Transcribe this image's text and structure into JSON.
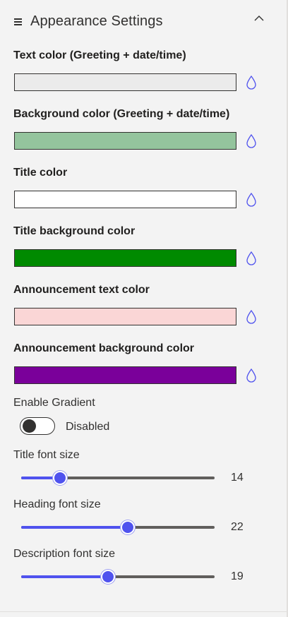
{
  "header": {
    "title": "Appearance Settings",
    "menu_icon": "hamburger-icon",
    "collapse_icon": "chevron-up-icon"
  },
  "colors": [
    {
      "label": "Text color (Greeting + date/time)",
      "value": "#ebebeb",
      "picker_icon": "color-drop-icon"
    },
    {
      "label": "Background color (Greeting + date/time)",
      "value": "#94c49d",
      "picker_icon": "color-drop-icon"
    },
    {
      "label": "Title color",
      "value": "#ffffff",
      "picker_icon": "color-drop-icon"
    },
    {
      "label": "Title background color",
      "value": "#008a00",
      "picker_icon": "color-drop-icon"
    },
    {
      "label": "Announcement text color",
      "value": "#fad6d6",
      "picker_icon": "color-drop-icon"
    },
    {
      "label": "Announcement background color",
      "value": "#7a009a",
      "picker_icon": "color-drop-icon"
    }
  ],
  "gradient": {
    "label": "Enable Gradient",
    "state_text": "Disabled",
    "enabled": false
  },
  "sliders": [
    {
      "label": "Title font size",
      "value": "14",
      "fraction": 0.2
    },
    {
      "label": "Heading font size",
      "value": "22",
      "fraction": 0.55
    },
    {
      "label": "Description font size",
      "value": "19",
      "fraction": 0.45
    }
  ],
  "theme": {
    "accent": "#4f52ee",
    "track": "#605e5c",
    "text": "#323130"
  }
}
